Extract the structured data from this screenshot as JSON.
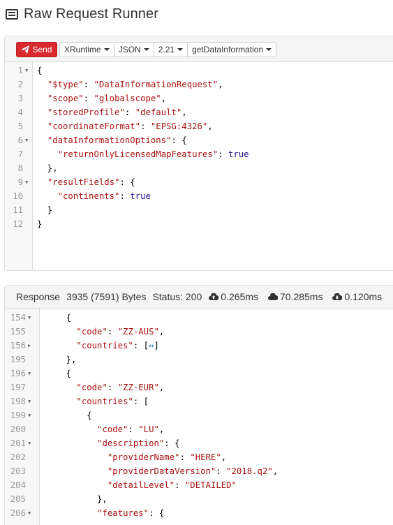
{
  "header": {
    "title": "Raw Request Runner"
  },
  "toolbar": {
    "send_label": "Send",
    "dropdowns": [
      "XRuntime",
      "JSON",
      "2.21",
      "getDataInformation"
    ]
  },
  "request_lines": [
    {
      "n": "1",
      "fold": "down",
      "code": "{"
    },
    {
      "n": "2",
      "code": "  \"$type\": \"DataInformationRequest\","
    },
    {
      "n": "3",
      "code": "  \"scope\": \"globalscope\","
    },
    {
      "n": "4",
      "code": "  \"storedProfile\": \"default\","
    },
    {
      "n": "5",
      "code": "  \"coordinateFormat\": \"EPSG:4326\","
    },
    {
      "n": "6",
      "fold": "down",
      "code": "  \"dataInformationOptions\": {"
    },
    {
      "n": "7",
      "code": "    \"returnOnlyLicensedMapFeatures\": true"
    },
    {
      "n": "8",
      "code": "  },"
    },
    {
      "n": "9",
      "fold": "down",
      "code": "  \"resultFields\": {"
    },
    {
      "n": "10",
      "code": "    \"continents\": true"
    },
    {
      "n": "11",
      "code": "  }"
    },
    {
      "n": "12",
      "code": "}"
    }
  ],
  "response": {
    "label": "Response",
    "bytes": "3935 (7591) Bytes",
    "status": "Status: 200",
    "timings": [
      "0.265ms",
      "70.285ms",
      "0.120ms"
    ]
  },
  "response_lines": [
    {
      "n": "154",
      "fold": "down",
      "code": "    {"
    },
    {
      "n": "155",
      "code": "      \"code\": \"ZZ-AUS\","
    },
    {
      "n": "156",
      "fold": "right",
      "code": "      \"countries\": [↔]"
    },
    {
      "n": "195",
      "code": "    },"
    },
    {
      "n": "196",
      "fold": "down",
      "code": "    {"
    },
    {
      "n": "197",
      "code": "      \"code\": \"ZZ-EUR\","
    },
    {
      "n": "198",
      "fold": "down",
      "code": "      \"countries\": ["
    },
    {
      "n": "199",
      "fold": "down",
      "code": "        {"
    },
    {
      "n": "200",
      "code": "          \"code\": \"LU\","
    },
    {
      "n": "201",
      "fold": "down",
      "code": "          \"description\": {"
    },
    {
      "n": "202",
      "code": "            \"providerName\": \"HERE\","
    },
    {
      "n": "203",
      "code": "            \"providerDataVersion\": \"2018.q2\","
    },
    {
      "n": "204",
      "code": "            \"detailLevel\": \"DETAILED\""
    },
    {
      "n": "205",
      "code": "          },"
    },
    {
      "n": "206",
      "fold": "down",
      "code": "          \"features\": {"
    }
  ],
  "colors": {
    "send": "#d9292d",
    "key": "#aa1111",
    "bool": "#221199"
  }
}
